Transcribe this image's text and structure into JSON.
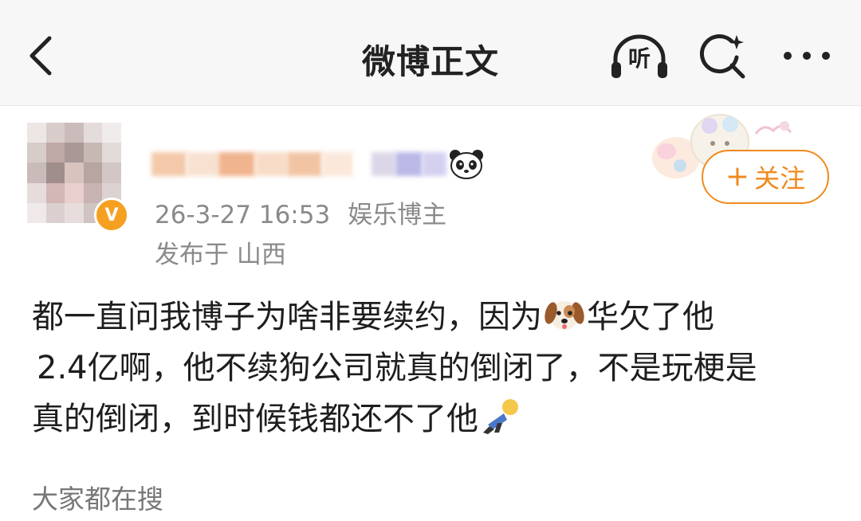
{
  "header": {
    "title": "微博正文",
    "listen_label": "听"
  },
  "post": {
    "timestamp": "26-3-27 16:53",
    "author_type": "娱乐博主",
    "location": "发布于 山西",
    "follow_label": "关注",
    "body_lines": [
      "都一直问我博子为啥非要续约，因为",
      "华欠了他",
      "2.4亿啊，他不续狗公司就真的倒闭了，不是玩梗是",
      "真的倒闭，到时候钱都还不了他"
    ]
  },
  "footer": {
    "trending_label": "大家都在搜"
  },
  "icons": {
    "back": "chevron-left-icon",
    "listen": "headphones-icon",
    "search": "ai-search-icon",
    "more": "more-dots-icon",
    "verified": "verified-badge-icon",
    "panda": "panda-emoji-icon",
    "dog": "dog-emoji",
    "person": "lying-person-emoji"
  },
  "colors": {
    "accent": "#f08a1e",
    "badge": "#f5a020",
    "meta_text": "#8a8a8a",
    "header_bg": "#f7f7f7"
  }
}
